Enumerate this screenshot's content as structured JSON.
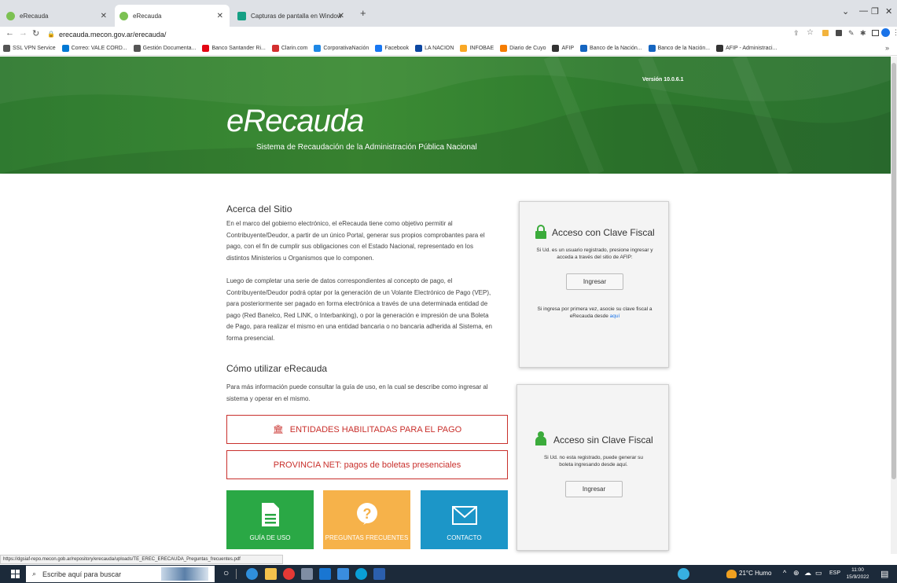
{
  "browser": {
    "tabs": [
      {
        "label": "eRecauda",
        "active": false
      },
      {
        "label": "eRecauda",
        "active": true
      },
      {
        "label": "Capturas de pantalla en Window",
        "active": false
      }
    ],
    "new_tab": "+",
    "url": "erecauda.mecon.gov.ar/erecauda/",
    "bookmarks": [
      {
        "label": "SSL VPN Service",
        "color": "#555"
      },
      {
        "label": "Correo: VALE CORD...",
        "color": "#0078d4"
      },
      {
        "label": "Gestión Documenta...",
        "color": "#555"
      },
      {
        "label": "Banco Santander Ri...",
        "color": "#e30613"
      },
      {
        "label": "Clarin.com",
        "color": "#d32f2f"
      },
      {
        "label": "CorporativaNación",
        "color": "#1e88e5"
      },
      {
        "label": "Facebook",
        "color": "#1877f2"
      },
      {
        "label": "LA NACION",
        "color": "#0d47a1"
      },
      {
        "label": "INFOBAE",
        "color": "#f9a825"
      },
      {
        "label": "Diario de Cuyo",
        "color": "#f57c00"
      },
      {
        "label": "AFIP",
        "color": "#333"
      },
      {
        "label": "Banco de la Nación...",
        "color": "#1565c0"
      },
      {
        "label": "Banco de la Nación...",
        "color": "#1565c0"
      },
      {
        "label": "AFIP - Administraci...",
        "color": "#333"
      }
    ],
    "bookmarks_more": "»"
  },
  "header": {
    "version": "Versión 10.0.6.1",
    "logo_text": "eRecauda",
    "subtitle": "Sistema de Recaudación de la Administración Pública Nacional"
  },
  "about": {
    "title": "Acerca del Sitio",
    "lines1": [
      "En el marco del gobierno electrónico, el eRecauda tiene como objetivo permitir al",
      "Contribuyente/Deudor, a partir de un único Portal, generar sus propios comprobantes para el",
      "pago, con el fin de cumplir sus obligaciones con el Estado Nacional, representado en los",
      "distintos Ministerios u Organismos que lo componen."
    ],
    "lines2": [
      "Luego de completar una serie de datos correspondientes al concepto de pago, el",
      "Contribuyente/Deudor podrá optar por la generación de un Volante Electrónico de Pago (VEP),",
      "para posteriormente ser pagado en forma electrónica a través de una determinada entidad de",
      "pago (Red Banelco, Red LINK, o Interbanking), o por la generación e impresión de una Boleta",
      "de Pago, para realizar el mismo en una entidad bancaria o no bancaria adherida al Sistema, en",
      "forma presencial."
    ]
  },
  "howto": {
    "title": "Cómo utilizar eRecauda",
    "lines": [
      "Para más información puede consultar la guía de uso, en la cual se describe como ingresar al",
      "sistema y operar en el mismo."
    ]
  },
  "links": {
    "entidades": "ENTIDADES HABILITADAS PARA EL PAGO",
    "provincia": "PROVINCIA NET: pagos de boletas presenciales"
  },
  "tiles": [
    {
      "label": "GUÍA DE USO",
      "color": "#2aa845",
      "icon": "document-icon"
    },
    {
      "label": "PREGUNTAS FRECUENTES",
      "color": "#f6b24a",
      "icon": "question-icon"
    },
    {
      "label": "CONTACTO",
      "color": "#1c96c8",
      "icon": "envelope-icon"
    }
  ],
  "login_fiscal": {
    "title": "Acceso con Clave Fiscal",
    "desc1": "Si Ud. es un usuario registrado, presione ingresar y",
    "desc2": "acceda a través del sitio de AFIP:",
    "button": "Ingresar",
    "note1": "Si ingresa por primera vez, asocie su clave fiscal a",
    "note2_prefix": "eRecauda desde ",
    "note2_link": "aquí"
  },
  "login_nofiscal": {
    "title": "Acceso sin Clave Fiscal",
    "desc1": "Si Ud. no esta registrado, puede generar su",
    "desc2": "boleta ingresando desde aquí.",
    "button": "Ingresar"
  },
  "statusbar": {
    "url": "https://dgsiaf-repo.mecon.gob.ar/repository/erecauda/uploads/TE_EREC_ERECAUDA_Preguntas_frecuentes.pdf"
  },
  "taskbar": {
    "search_placeholder": "Escribe aquí para buscar",
    "weather": "21°C Humo",
    "lang": "ESP",
    "time": "11:00",
    "date": "15/9/2022"
  }
}
